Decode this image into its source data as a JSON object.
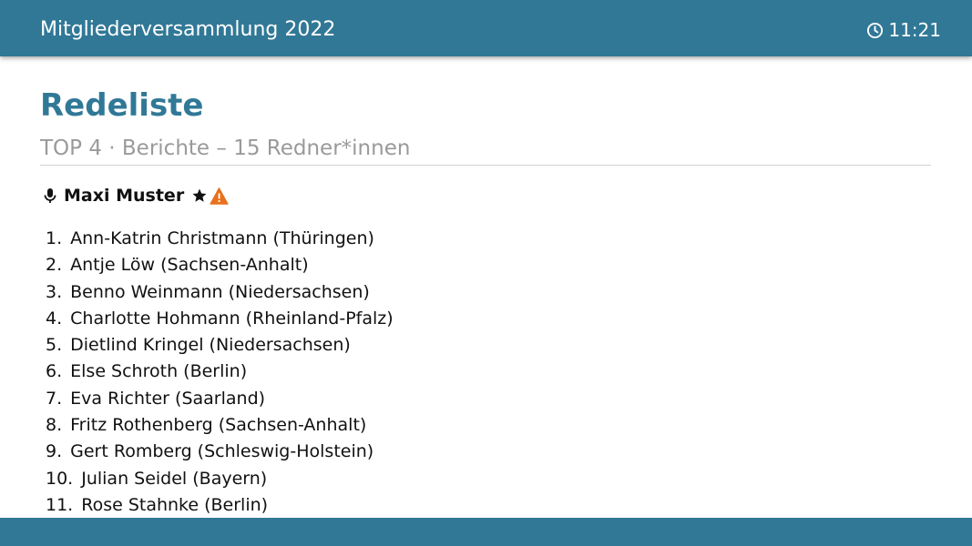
{
  "header": {
    "title": "Mitgliederversammlung 2022",
    "clock_icon": "clock-icon",
    "time": "11:21"
  },
  "page": {
    "title": "Redeliste",
    "subtitle": "TOP 4 · Berichte – 15 Redner*innen"
  },
  "current_speaker": {
    "icon": "microphone-icon",
    "name": "Maxi Muster",
    "badges": [
      "star-icon",
      "warning-icon"
    ],
    "warning_color": "#e8711c"
  },
  "speakers": [
    {
      "number": "1.",
      "name": "Ann-Katrin Christmann (Thüringen)"
    },
    {
      "number": "2.",
      "name": "Antje Löw (Sachsen-Anhalt)"
    },
    {
      "number": "3.",
      "name": "Benno Weinmann (Niedersachsen)"
    },
    {
      "number": "4.",
      "name": "Charlotte Hohmann (Rheinland-Pfalz)"
    },
    {
      "number": "5.",
      "name": "Dietlind Kringel (Niedersachsen)"
    },
    {
      "number": "6.",
      "name": "Else Schroth (Berlin)"
    },
    {
      "number": "7.",
      "name": "Eva Richter (Saarland)"
    },
    {
      "number": "8.",
      "name": "Fritz Rothenberg (Sachsen-Anhalt)"
    },
    {
      "number": "9.",
      "name": "Gert Romberg (Schleswig-Holstein)"
    },
    {
      "number": "10.",
      "name": "Julian Seidel (Bayern)"
    },
    {
      "number": "11.",
      "name": "Rose Stahnke (Berlin)"
    }
  ],
  "theme": {
    "primary": "#317897",
    "muted_text": "#9a9a9a"
  }
}
